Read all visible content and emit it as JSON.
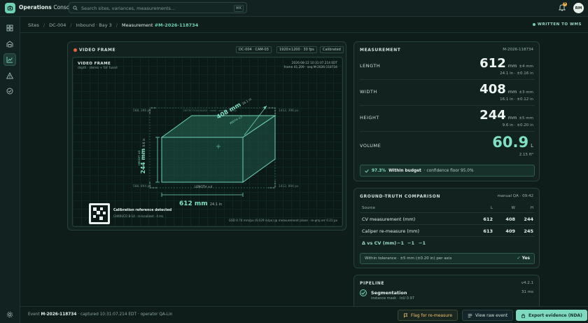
{
  "app": {
    "title_bold": "Operations",
    "title_rest": "Console"
  },
  "search": {
    "placeholder": "Search sites, variances, measurements...",
    "shortcut": "⌘K"
  },
  "notifications": {
    "count": "5"
  },
  "user": {
    "initials": "RM"
  },
  "sidebar": {
    "items": [
      "grid-icon",
      "warehouse-icon",
      "chart-icon",
      "alert-icon",
      "check-circle-icon"
    ],
    "active": "chart-icon",
    "bottom": "settings-icon"
  },
  "breadcrumb": {
    "items": [
      "Sites",
      "DC-004",
      "Inbound · Bay 3",
      "Measurement"
    ],
    "id": "#M-2026-118734"
  },
  "written": "WRITTEN TO WMS",
  "video": {
    "title": "VIDEO FRAME",
    "chips": [
      "DC-004 · CAM-03",
      "1920×1200 · 30 fps",
      "Calibrated"
    ],
    "frame_title": "VIDEO FRAME",
    "frame_sub": "depth · stereo + ToF fused",
    "timestamp": "2026-08-22 10:31:07.214 EDT",
    "frame_info": "frame 41,209 · seq M-2026-118734",
    "coords": {
      "tl": {
        "v": "588, 396",
        "u": "px"
      },
      "tr": {
        "v": "1412, 396",
        "u": "px"
      },
      "bl": {
        "v": "588, 894",
        "u": "px"
      },
      "br": {
        "v": "1412, 894",
        "u": "px"
      }
    },
    "detection_mask": "DETECTION MASK · rvals · anchor CV-2p",
    "dim_width": "408 mm",
    "dim_width_sub": "16.1 in",
    "dim_width_tag": "WIDTH ±3",
    "dim_height": "244 mm",
    "dim_height_sub": "9.6 in",
    "dim_height_tag": "HEIGHT ±5",
    "dim_length_tag": "LENGTH ±4",
    "length_value": "612 mm",
    "length_sub": "24.1 in",
    "calib_title": "Calibration reference detected",
    "calib_sub": "CHARUCO B-14 · re-localized · 4 ms",
    "gsd": "GSD 0.74 mm/px (0.029 in/px) @ measurement plane · re-proj err 0.21 px"
  },
  "measurement": {
    "title": "MEASUREMENT",
    "id": "M-2026-118734",
    "rows": [
      {
        "label": "LENGTH",
        "value": "612",
        "unit": "mm",
        "tol": "±4 mm",
        "sub": "24.1 in · ±0.16 in"
      },
      {
        "label": "WIDTH",
        "value": "408",
        "unit": "mm",
        "tol": "±3 mm",
        "sub": "16.1 in · ±0.12 in"
      },
      {
        "label": "HEIGHT",
        "value": "244",
        "unit": "mm",
        "tol": "±5 mm",
        "sub": "9.6 in · ±0.20 in"
      }
    ],
    "volume": {
      "label": "VOLUME",
      "value": "60.9",
      "unit": "L",
      "sub": "2.15 ft³"
    },
    "budget": {
      "pct": "97.3%",
      "label": "Within budget",
      "detail": "· confidence floor 95.0%"
    }
  },
  "ground_truth": {
    "title": "GROUND-TRUTH COMPARISON",
    "meta": "manual QA · 09:42",
    "headers": [
      "Source",
      "L",
      "W",
      "H"
    ],
    "rows": [
      {
        "source": "CV measurement (mm)",
        "l": "612",
        "w": "408",
        "h": "244"
      },
      {
        "source": "Caliper re-measure (mm)",
        "l": "613",
        "w": "409",
        "h": "245"
      }
    ],
    "delta": {
      "label": "Δ vs CV (mm)",
      "l": "−1",
      "w": "−1",
      "h": "−1"
    },
    "tolerance": "Within tolerance · ±5 mm (±0.20 in) per axis",
    "tolerance_result": "Yes"
  },
  "pipeline": {
    "title": "PIPELINE",
    "version": "v4.2.1",
    "step": {
      "name": "Segmentation",
      "sub": "instance mask · IoU 0.97",
      "time": "31 ms"
    }
  },
  "footer": {
    "event_label": "Event",
    "event_id": "M-2026-118734",
    "event_rest": "· captured 10:31:07.214 EDT · operator QA-Lin",
    "flag_btn": "Flag for re-measure",
    "raw_btn": "View raw event",
    "export_btn": "Export evidence (NDA)"
  },
  "colors": {
    "accent": "#6fd0b4",
    "background": "#0f1d1a",
    "panel": "#12231f",
    "warning": "#f0c670"
  }
}
